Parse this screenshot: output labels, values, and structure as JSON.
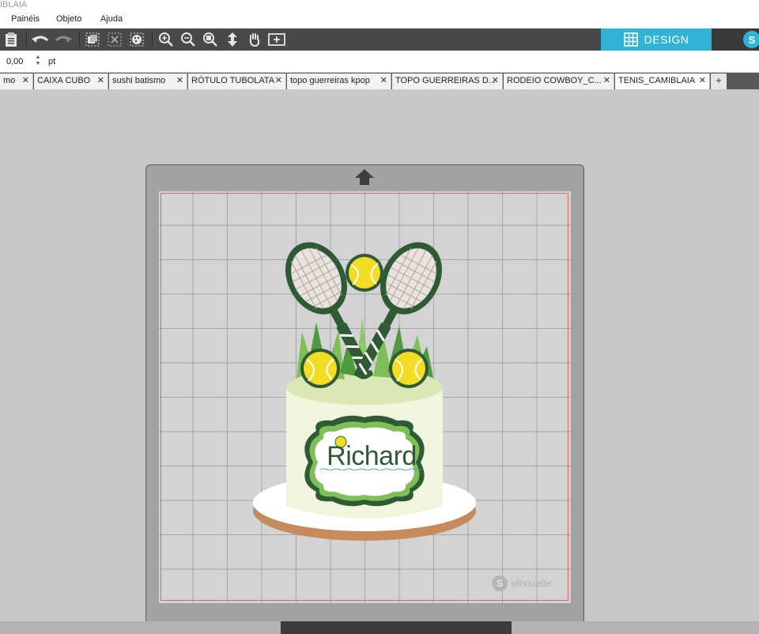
{
  "window": {
    "title": "IBLAIA"
  },
  "menu": {
    "items": [
      "Painéis",
      "Objeto",
      "Ajuda"
    ]
  },
  "toolbar": {
    "icons": [
      "clipboard-icon",
      "undo-icon",
      "redo-icon",
      "group-icon",
      "ungroup-icon",
      "fill-icon",
      "zoom-in-icon",
      "zoom-out-icon",
      "zoom-select-icon",
      "move-down-icon",
      "pan-hand-icon",
      "fit-page-icon"
    ],
    "design_label": "DESIGN",
    "accent": "#2fb3d6"
  },
  "properties": {
    "value": "0,00",
    "unit": "pt"
  },
  "tabs": [
    {
      "label": "mo"
    },
    {
      "label": "CAIXA CUBO"
    },
    {
      "label": "sushi batismo"
    },
    {
      "label": "RÓTULO TUBOLATA"
    },
    {
      "label": "topo guerreiras kpop"
    },
    {
      "label": "TOPO GUERREIRAS D..."
    },
    {
      "label": "RODEIO COWBOY_C..."
    },
    {
      "label": "TENIS_CAMIBLAIA"
    }
  ],
  "add_tab": "+",
  "canvas": {
    "design_text": "Richard",
    "watermark": "silhouette"
  }
}
